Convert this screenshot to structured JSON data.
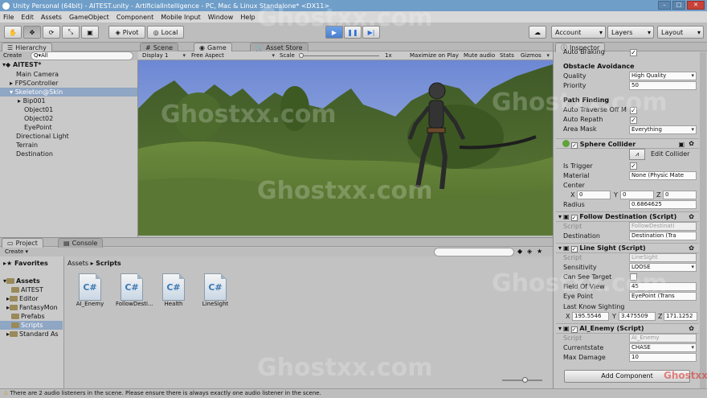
{
  "title": "Unity Personal (64bit) - AITEST.unity - ArtificialIntelligence - PC, Mac & Linux Standalone* <DX11>",
  "menu": [
    "File",
    "Edit",
    "Assets",
    "GameObject",
    "Component",
    "Mobile Input",
    "Window",
    "Help"
  ],
  "toolbar": {
    "pivot": "Pivot",
    "local": "Local",
    "account": "Account",
    "layers": "Layers",
    "layout": "Layout"
  },
  "hierarchy": {
    "tab": "Hierarchy",
    "create": "Create",
    "search": "Q▾All",
    "scene": "AITEST*",
    "items": [
      "Main Camera",
      "FPSController",
      "Skeleton@Skin",
      "Bip001",
      "Object01",
      "Object02",
      "EyePoint",
      "Directional Light",
      "Terrain",
      "Destination"
    ]
  },
  "scene_tabs": {
    "scene": "Scene",
    "game": "Game",
    "asset_store": "Asset Store"
  },
  "game_bar": {
    "display": "Display 1",
    "aspect": "Free Aspect",
    "scale": "Scale",
    "scale_val": "1x",
    "maximize": "Maximize on Play",
    "mute": "Mute audio",
    "stats": "Stats",
    "gizmos": "Gizmos"
  },
  "project": {
    "tab": "Project",
    "console": "Console",
    "create": "Create",
    "favorites": "Favorites",
    "assets": "Assets",
    "folders": [
      "AITEST",
      "Editor",
      "FantasyMon",
      "Prefabs",
      "Scripts",
      "Standard As"
    ],
    "breadcrumb": [
      "Assets",
      "Scripts"
    ],
    "files": [
      "AI_Enemy",
      "FollowDesti...",
      "Health",
      "LineSight"
    ]
  },
  "inspector": {
    "tab": "Inspector",
    "auto_braking": "Auto Braking",
    "obstacle_section": "Obstacle Avoidance",
    "quality_label": "Quality",
    "quality": "High Quality",
    "priority_label": "Priority",
    "priority": "50",
    "path_section": "Path Finding",
    "auto_traverse": "Auto Traverse Off M",
    "auto_repath": "Auto Repath",
    "area_mask_label": "Area Mask",
    "area_mask": "Everything",
    "sphere_title": "Sphere Collider",
    "edit_collider": "Edit Collider",
    "is_trigger": "Is Trigger",
    "material_label": "Material",
    "material": "None (Physic Mate",
    "center_label": "Center",
    "center_x": "0",
    "center_y": "0",
    "center_z": "0",
    "radius_label": "Radius",
    "radius": "0.6864625",
    "follow_title": "Follow Destination (Script)",
    "follow_script": "FollowDestinati",
    "destination_label": "Destination",
    "destination": "Destination (Tra",
    "line_title": "Line Sight (Script)",
    "line_script": "LineSight",
    "sensitivity_label": "Sensitivity",
    "sensitivity": "LOOSE",
    "can_see_label": "Can See Target",
    "fov_label": "Field Of View",
    "fov": "45",
    "eye_label": "Eye Point",
    "eye": "EyePoint (Trans",
    "last_label": "Last Know Sighting",
    "last_x": "195.5546",
    "last_y": "3.475509",
    "last_z": "171.1252",
    "ai_title": "AI_Enemy (Script)",
    "ai_script": "AI_Enemy",
    "state_label": "Currentstate",
    "state": "CHASE",
    "dmg_label": "Max Damage",
    "dmg": "10",
    "script_label": "Script",
    "add_component": "Add Component"
  },
  "status": "There are 2 audio listeners in the scene. Please ensure there is always exactly one audio listener in the scene.",
  "watermark": "Ghostxx.com",
  "watermark_logo": "Ghostxx"
}
